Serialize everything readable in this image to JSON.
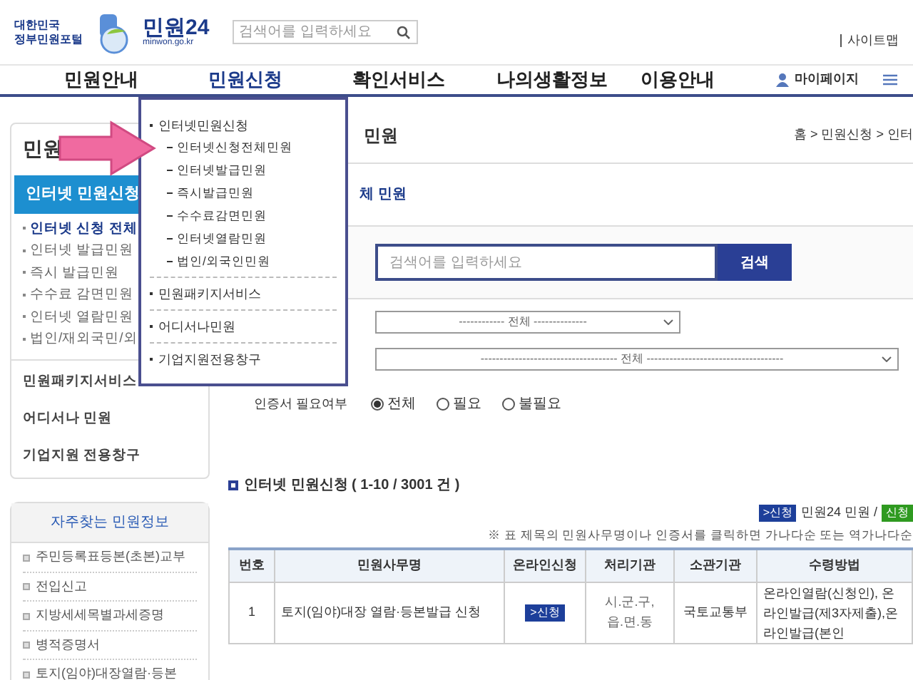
{
  "header": {
    "portal": [
      "대한민국",
      "정부민원포털"
    ],
    "brand": "민원24",
    "brand_url": "minwon.go.kr",
    "search_placeholder": "검색어를 입력하세요",
    "sitemap": "사이트맵"
  },
  "nav": {
    "items": [
      {
        "label": "민원안내",
        "expanded": false
      },
      {
        "label": "민원신청",
        "expanded": true
      },
      {
        "label": "확인서비스",
        "expanded": false
      },
      {
        "label": "나의생활정보",
        "expanded": false
      },
      {
        "label": "이용안내",
        "expanded": false
      }
    ],
    "mypage": "마이페이지"
  },
  "dropdown": [
    {
      "label": "인터넷민원신청",
      "children": [
        {
          "label": "인터넷신청전체민원"
        },
        {
          "label": "인터넷발급민원"
        },
        {
          "label": "즉시발급민원"
        },
        {
          "label": "수수료감면민원"
        },
        {
          "label": "인터넷열람민원"
        },
        {
          "label": "법인/외국인민원"
        }
      ]
    },
    {
      "label": "민원패키지서비스"
    },
    {
      "label": "어디서나민원"
    },
    {
      "label": "기업지원전용창구"
    }
  ],
  "sidebar": {
    "title": "민원",
    "section": {
      "label": "인터넷 민원신청",
      "selected": true
    },
    "items": [
      {
        "label": "인터넷 신청 전체",
        "selected": true
      },
      {
        "label": "인터넷 발급민원",
        "selected": false
      },
      {
        "label": "즉시 발급민원",
        "selected": false
      },
      {
        "label": "수수료 감면민원",
        "selected": false
      },
      {
        "label": "인터넷 열람민원",
        "selected": false
      },
      {
        "label": "법인/재외국민/외",
        "selected": false
      }
    ],
    "groups": [
      "민원패키지서비스",
      "어디서나 민원",
      "기업지원 전용창구"
    ]
  },
  "popular": {
    "title": "자주찾는 민원정보",
    "items": [
      "주민등록표등본(초본)교부",
      "전입신고",
      "지방세세목별과세증명",
      "병적증명서",
      "토지(임야)대장열람·등본"
    ]
  },
  "page": {
    "title": "민원",
    "breadcrumb": "홈 > 민원신청 > 인터",
    "subtitle": "체 민원"
  },
  "search": {
    "placeholder": "검색어를 입력하세요",
    "button": "검색"
  },
  "filters": [
    {
      "value": "------------ 전체 --------------",
      "wide": false
    },
    {
      "value": "------------------------------------ 전체 ------------------------------------",
      "wide": true
    }
  ],
  "cert": {
    "label": "인증서 필요여부",
    "options": [
      {
        "label": "전체",
        "selected": true
      },
      {
        "label": "필요",
        "selected": false
      },
      {
        "label": "불필요",
        "selected": false
      }
    ]
  },
  "list": {
    "title": "인터넷 민원신청 ( 1-10 / 3001 건 )",
    "legend_badge": ">신청",
    "legend_text": "민원24 민원 /",
    "legend_badge2": "신청",
    "note": "※ 표 제목의 민원사무명이나 인증서를 클릭하면 가나다순 또는 역가나다순",
    "columns": [
      "번호",
      "민원사무명",
      "온라인신청",
      "처리기관",
      "소관기관",
      "수령방법"
    ],
    "rows": [
      {
        "no": "1",
        "name": "토지(임야)대장 열람·등본발급 신청",
        "apply": ">신청",
        "agency": "시.군.구, 읍.면.동",
        "ministry": "국토교통부",
        "method": "온라인열람(신청인), 온라인발급(제3자제출),온라인발급(본인"
      }
    ]
  }
}
